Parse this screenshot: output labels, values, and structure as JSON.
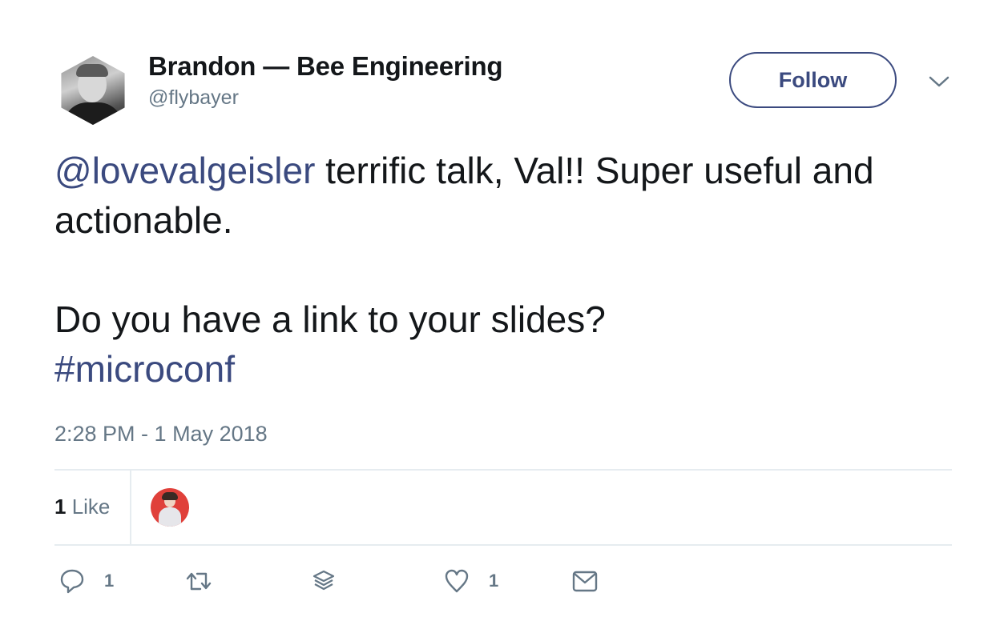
{
  "author": {
    "display_name": "Brandon — Bee Engineering",
    "handle": "@flybayer",
    "avatar_icon": "profile-photo-hexagon"
  },
  "header": {
    "follow_label": "Follow",
    "more_icon": "chevron-down-icon"
  },
  "tweet": {
    "mention": "@lovevalgeisler",
    "line1_rest": " terrific talk, Val!! Super useful and actionable.",
    "line2": "Do you have a link to your slides?",
    "hashtag": "#microconf",
    "timestamp": "2:28 PM - 1 May 2018"
  },
  "stats": {
    "like_count": "1",
    "like_label": " Like"
  },
  "actions": {
    "reply_count": "1",
    "retweet_count": "",
    "like_count": "1"
  },
  "colors": {
    "accent": "#3b4a7f",
    "muted": "#657786",
    "text": "#14171a",
    "divider": "#e6ecf0"
  }
}
